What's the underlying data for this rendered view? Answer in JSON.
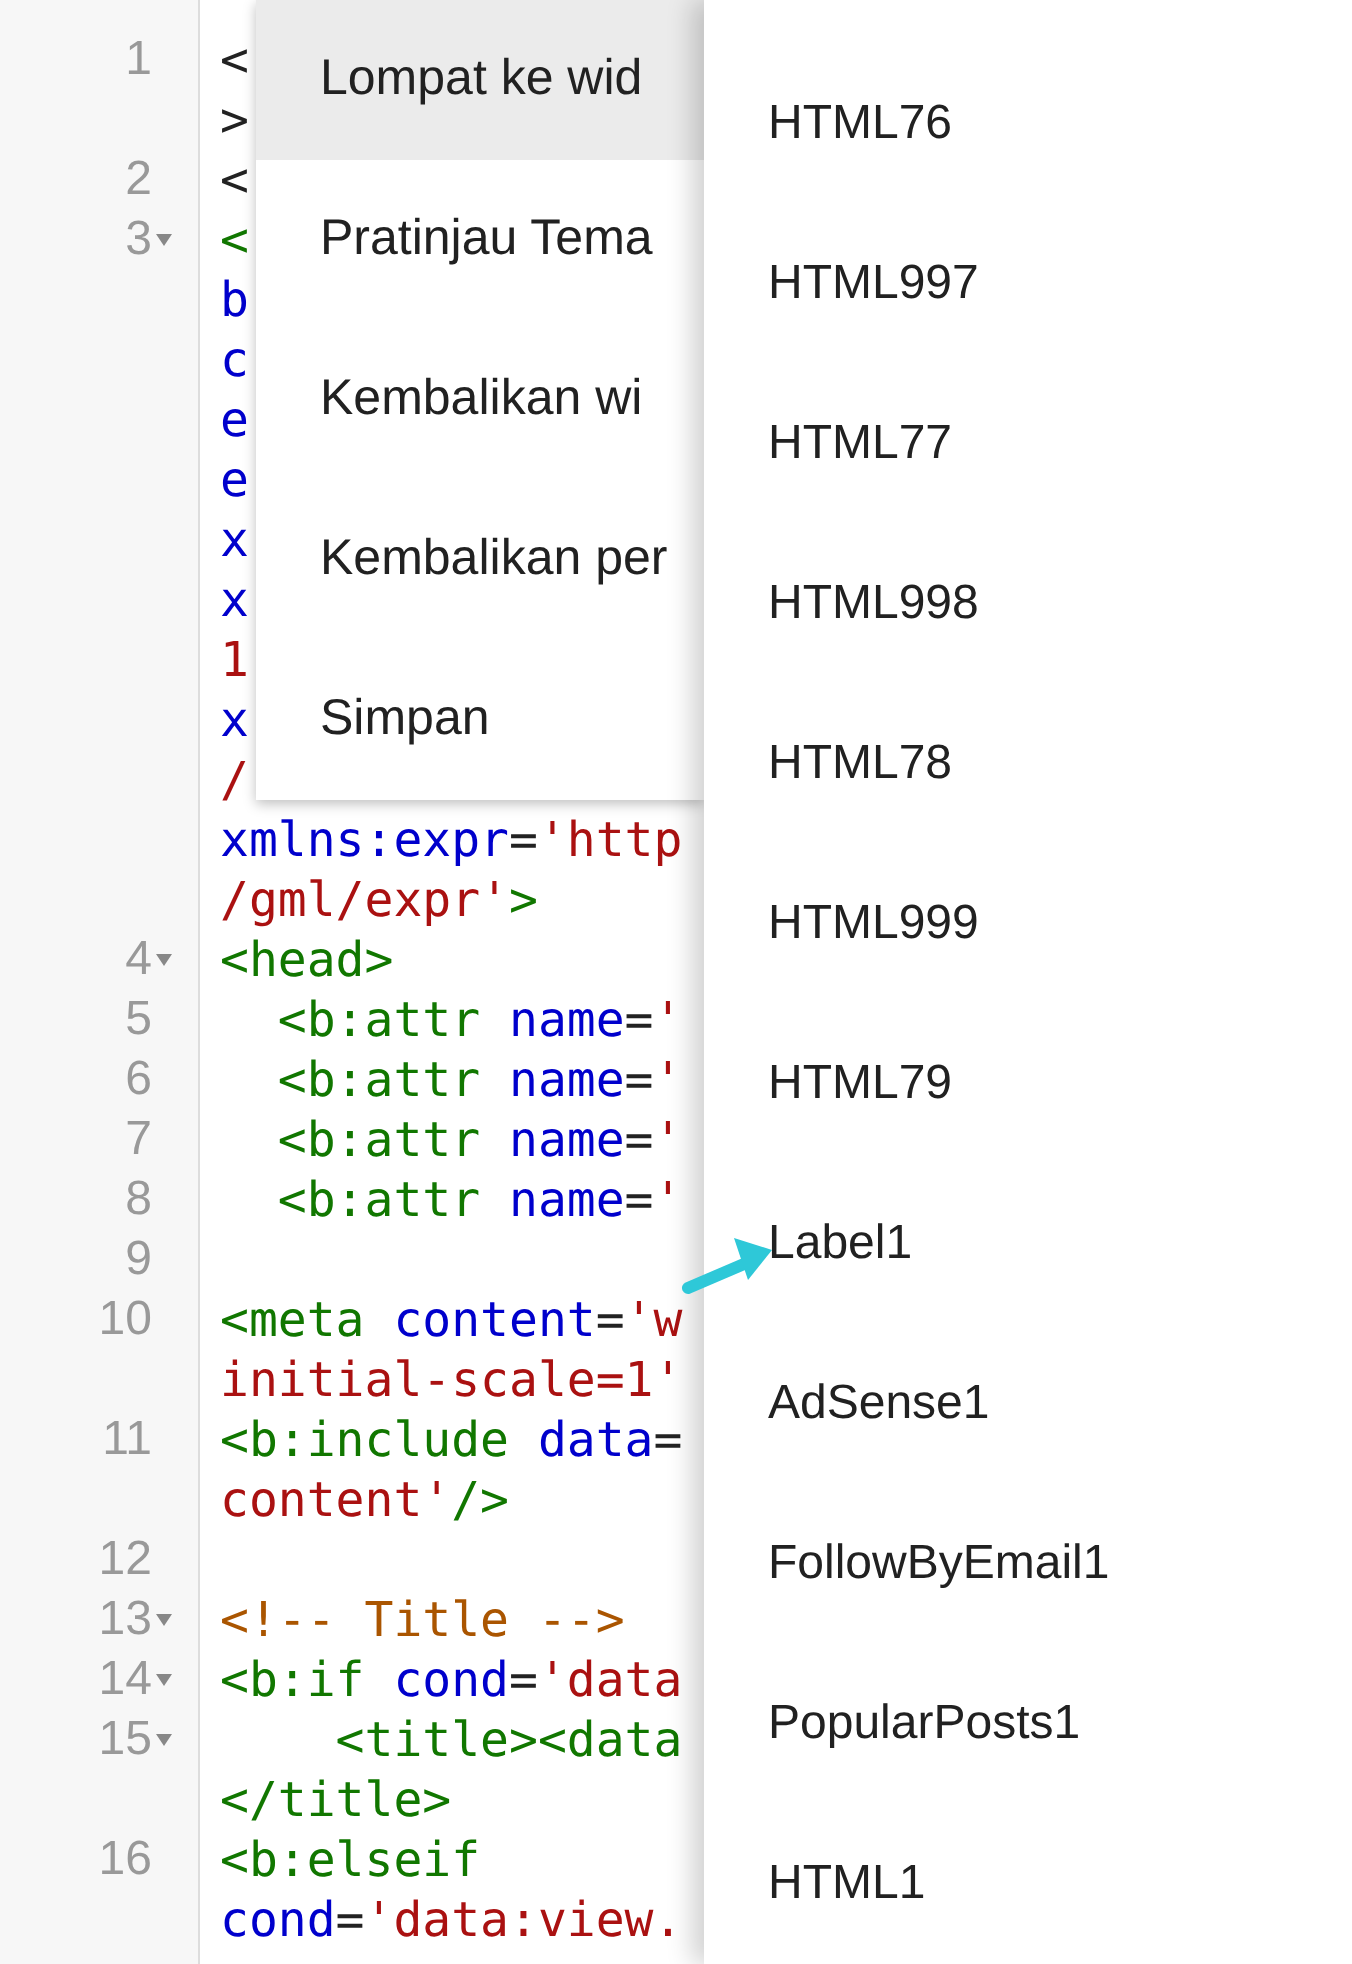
{
  "editor": {
    "rows": [
      {
        "number": "1",
        "fold": false,
        "tokens": [
          {
            "kind": "plain",
            "text": "<"
          }
        ]
      },
      {
        "tokens": [
          {
            "kind": "plain",
            "text": ">"
          }
        ]
      },
      {
        "number": "2",
        "fold": false,
        "tokens": [
          {
            "kind": "plain",
            "text": "<"
          }
        ]
      },
      {
        "number": "3",
        "fold": true,
        "tokens": [
          {
            "kind": "tag",
            "text": "<"
          }
        ]
      },
      {
        "tokens": [
          {
            "kind": "attr",
            "text": "b"
          }
        ]
      },
      {
        "tokens": [
          {
            "kind": "attr",
            "text": "c"
          }
        ]
      },
      {
        "tokens": [
          {
            "kind": "attr",
            "text": "e"
          }
        ]
      },
      {
        "tokens": [
          {
            "kind": "attr",
            "text": "e"
          }
        ]
      },
      {
        "tokens": [
          {
            "kind": "attr",
            "text": "x"
          }
        ]
      },
      {
        "tokens": [
          {
            "kind": "attr",
            "text": "x"
          }
        ]
      },
      {
        "tokens": [
          {
            "kind": "string",
            "text": "1"
          }
        ]
      },
      {
        "tokens": [
          {
            "kind": "attr",
            "text": "x"
          }
        ]
      },
      {
        "tokens": [
          {
            "kind": "string",
            "text": "/"
          }
        ]
      },
      {
        "tokens": [
          {
            "kind": "attr",
            "text": "xmlns:expr"
          },
          {
            "kind": "plain",
            "text": "="
          },
          {
            "kind": "string",
            "text": "'http"
          }
        ]
      },
      {
        "tokens": [
          {
            "kind": "string",
            "text": "/gml/expr'"
          },
          {
            "kind": "tag",
            "text": ">"
          }
        ]
      },
      {
        "number": "4",
        "fold": true,
        "tokens": [
          {
            "kind": "tag",
            "text": "<head>"
          }
        ]
      },
      {
        "number": "5",
        "fold": false,
        "tokens": [
          {
            "kind": "tag",
            "text": "  <b:attr"
          },
          {
            "kind": "attr",
            "text": " name"
          },
          {
            "kind": "plain",
            "text": "="
          },
          {
            "kind": "string",
            "text": "'"
          }
        ]
      },
      {
        "number": "6",
        "fold": false,
        "tokens": [
          {
            "kind": "tag",
            "text": "  <b:attr"
          },
          {
            "kind": "attr",
            "text": " name"
          },
          {
            "kind": "plain",
            "text": "="
          },
          {
            "kind": "string",
            "text": "'"
          }
        ]
      },
      {
        "number": "7",
        "fold": false,
        "tokens": [
          {
            "kind": "tag",
            "text": "  <b:attr"
          },
          {
            "kind": "attr",
            "text": " name"
          },
          {
            "kind": "plain",
            "text": "="
          },
          {
            "kind": "string",
            "text": "'"
          }
        ]
      },
      {
        "number": "8",
        "fold": false,
        "tokens": [
          {
            "kind": "tag",
            "text": "  <b:attr"
          },
          {
            "kind": "attr",
            "text": " name"
          },
          {
            "kind": "plain",
            "text": "="
          },
          {
            "kind": "string",
            "text": "'"
          }
        ]
      },
      {
        "number": "9",
        "fold": false
      },
      {
        "number": "10",
        "fold": false,
        "tokens": [
          {
            "kind": "tag",
            "text": "<meta"
          },
          {
            "kind": "attr",
            "text": " content"
          },
          {
            "kind": "plain",
            "text": "="
          },
          {
            "kind": "string",
            "text": "'w"
          }
        ]
      },
      {
        "tokens": [
          {
            "kind": "string",
            "text": "initial-scale=1'"
          }
        ]
      },
      {
        "number": "11",
        "fold": false,
        "tokens": [
          {
            "kind": "tag",
            "text": "<b:include"
          },
          {
            "kind": "attr",
            "text": " data"
          },
          {
            "kind": "plain",
            "text": "="
          }
        ]
      },
      {
        "tokens": [
          {
            "kind": "string",
            "text": "content'"
          },
          {
            "kind": "tag",
            "text": "/>"
          }
        ]
      },
      {
        "number": "12",
        "fold": false
      },
      {
        "number": "13",
        "fold": true,
        "tokens": [
          {
            "kind": "comment",
            "text": "<!-- Title -->"
          }
        ]
      },
      {
        "number": "14",
        "fold": true,
        "tokens": [
          {
            "kind": "tag",
            "text": "<b:if"
          },
          {
            "kind": "attr",
            "text": " cond"
          },
          {
            "kind": "plain",
            "text": "="
          },
          {
            "kind": "string",
            "text": "'data"
          }
        ]
      },
      {
        "number": "15",
        "fold": true,
        "tokens": [
          {
            "kind": "tag",
            "text": "    <title><data"
          }
        ]
      },
      {
        "tokens": [
          {
            "kind": "tag",
            "text": "</title>"
          }
        ]
      },
      {
        "number": "16",
        "fold": false,
        "tokens": [
          {
            "kind": "tag",
            "text": "<b:elseif"
          }
        ]
      },
      {
        "tokens": [
          {
            "kind": "attr",
            "text": "cond"
          },
          {
            "kind": "plain",
            "text": "="
          },
          {
            "kind": "string",
            "text": "'data:view."
          }
        ]
      }
    ]
  },
  "menu": {
    "items": [
      {
        "label": "Lompat ke wid",
        "selected": true
      },
      {
        "label": "Pratinjau Tema",
        "selected": false
      },
      {
        "label": "Kembalikan wi",
        "selected": false
      },
      {
        "label": "Kembalikan per",
        "selected": false
      },
      {
        "label": "Simpan",
        "selected": false
      }
    ]
  },
  "widget_list": {
    "items": [
      "HTML76",
      "HTML997",
      "HTML77",
      "HTML998",
      "HTML78",
      "HTML999",
      "HTML79",
      "Label1",
      "AdSense1",
      "FollowByEmail1",
      "PopularPosts1",
      "HTML1"
    ]
  }
}
